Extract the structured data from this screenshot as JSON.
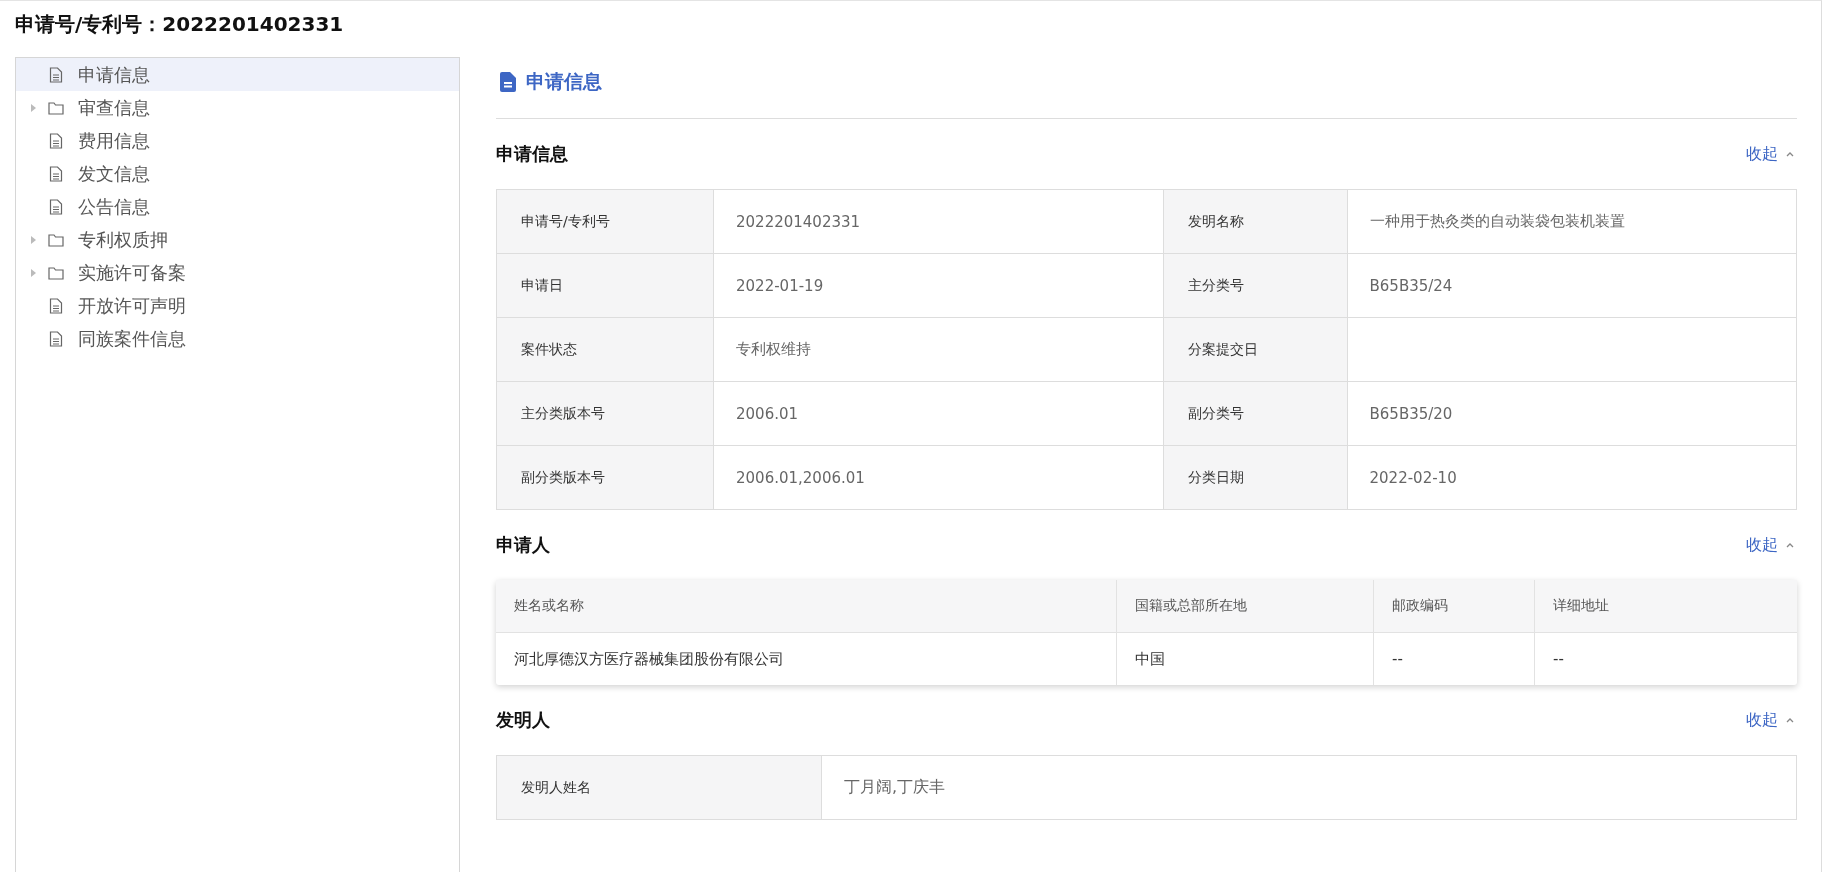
{
  "page_title": "申请号/专利号：2022201402331",
  "sidebar": {
    "items": [
      {
        "label": "申请信息",
        "kind": "file",
        "selected": true
      },
      {
        "label": "审查信息",
        "kind": "folder",
        "selected": false,
        "expanded": false
      },
      {
        "label": "费用信息",
        "kind": "file",
        "selected": false
      },
      {
        "label": "发文信息",
        "kind": "file",
        "selected": false
      },
      {
        "label": "公告信息",
        "kind": "file",
        "selected": false
      },
      {
        "label": "专利权质押",
        "kind": "folder",
        "selected": false,
        "expanded": false
      },
      {
        "label": "实施许可备案",
        "kind": "folder",
        "selected": false,
        "expanded": false
      },
      {
        "label": "开放许可声明",
        "kind": "file",
        "selected": false
      },
      {
        "label": "同族案件信息",
        "kind": "file",
        "selected": false
      }
    ]
  },
  "content": {
    "title": "申请信息",
    "sections": [
      {
        "kind": "fields",
        "title": "申请信息",
        "toggle": "收起",
        "expanded": true,
        "rows": [
          [
            {
              "label": "申请号/专利号",
              "value": "2022201402331"
            },
            {
              "label": "发明名称",
              "value": "一种用于热灸类的自动装袋包装机装置"
            }
          ],
          [
            {
              "label": "申请日",
              "value": "2022-01-19"
            },
            {
              "label": "主分类号",
              "value": "B65B35/24"
            }
          ],
          [
            {
              "label": "案件状态",
              "value": "专利权维持"
            },
            {
              "label": "分案提交日"
            }
          ],
          [
            {
              "label": "主分类版本号",
              "value": "2006.01"
            },
            {
              "label": "副分类号",
              "value": "B65B35/20"
            }
          ],
          [
            {
              "label": "副分类版本号",
              "value": "2006.01,2006.01"
            },
            {
              "label": "分类日期",
              "value": "2022-02-10"
            }
          ]
        ]
      },
      {
        "kind": "table",
        "title": "申请人",
        "toggle": "收起",
        "expanded": true,
        "columns": [
          "姓名或名称",
          "国籍或总部所在地",
          "邮政编码",
          "详细地址"
        ],
        "rows": [
          [
            "河北厚德汉方医疗器械集团股份有限公司",
            "中国",
            "--",
            "--"
          ]
        ]
      },
      {
        "kind": "single",
        "title": "发明人",
        "toggle": "收起",
        "expanded": true,
        "label": "发明人姓名",
        "value": "丁月阔,丁庆丰"
      }
    ]
  }
}
